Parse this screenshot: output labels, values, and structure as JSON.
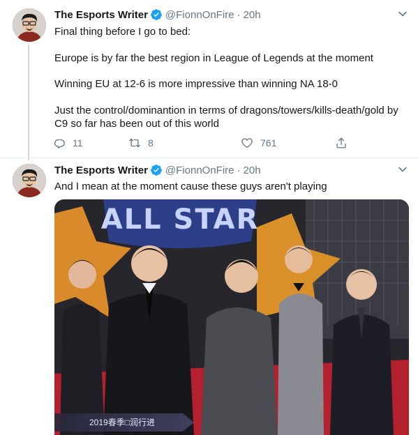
{
  "tweets": [
    {
      "display_name": "The Esports Writer",
      "handle": "@FionnOnFire",
      "separator": "·",
      "time": "20h",
      "paragraphs": [
        "Final thing before I go to bed:",
        "Europe is by far the best region in League of Legends at the moment",
        "Winning EU at 12-6 is more impressive than winning NA 18-0",
        "Just the control/dominantion in terms of dragons/towers/kills-death/gold by",
        "C9 so far has been out of this world"
      ],
      "reply_count": "11",
      "retweet_count": "8",
      "like_count": "761"
    },
    {
      "display_name": "The Esports Writer",
      "handle": "@FionnOnFire",
      "separator": "·",
      "time": "20h",
      "text": "And I mean at the moment cause these guys aren't playing",
      "media": {
        "banner_text": "ALL STAR",
        "caption": "2019春季□润行进"
      }
    }
  ],
  "icons": {
    "verified": "verified-badge-icon",
    "caret": "chevron-down-icon",
    "reply": "reply-icon",
    "retweet": "retweet-icon",
    "like": "heart-icon",
    "share": "share-icon"
  },
  "colors": {
    "accent": "#1da1f2",
    "secondary_text": "#657786",
    "primary_text": "#14171a",
    "divider": "#e6ecf0"
  }
}
